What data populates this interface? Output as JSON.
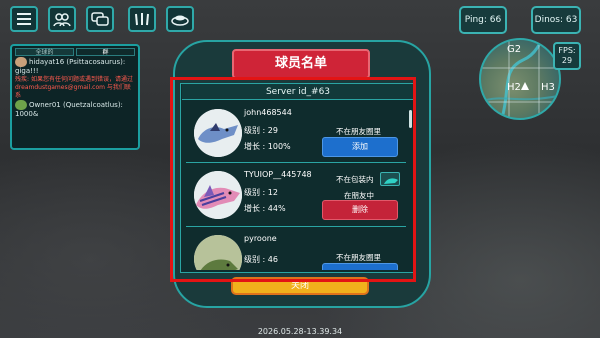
{
  "top_buttons": [
    {
      "name": "menu-button",
      "icon": "hamburger-icon"
    },
    {
      "name": "friends-button",
      "icon": "people-icon"
    },
    {
      "name": "chat-button",
      "icon": "chat-bubbles-icon"
    },
    {
      "name": "dino-button",
      "icon": "claw-icon"
    },
    {
      "name": "nest-button",
      "icon": "nest-icon"
    }
  ],
  "stats": {
    "ping": "Ping: 66",
    "dinos": "Dinos: 63",
    "fps_label": "FPS:",
    "fps_value": "29"
  },
  "chat": {
    "tabs": [
      "全球的",
      "群"
    ],
    "messages": [
      {
        "user": "hidayat16 (Psittacosaurus):",
        "text": "giga!!!"
      },
      {
        "system_label": "残疾:",
        "system_text": "如果您有任何问题或遇到错误，请通过 dreamdustgames@gmail.com 与我们联系"
      },
      {
        "user": "Owner01 (Quetzalcoatlus):",
        "text": "1000&"
      }
    ]
  },
  "map": {
    "labels": [
      "G2",
      "H2",
      "H3"
    ]
  },
  "dialog": {
    "title": "球员名单",
    "server": "Server id_#63",
    "players": [
      {
        "name": "john468544",
        "level": "级别 : 29",
        "growth": "增长 : 100%",
        "status": "不在朋友圈里",
        "status2": "",
        "action": "添加",
        "action_type": "add"
      },
      {
        "name": "TYUIOP__445748",
        "level": "级别 : 12",
        "growth": "增长 : 44%",
        "status": "不在包装内",
        "status2": "在朋友中",
        "action": "删除",
        "action_type": "remove"
      },
      {
        "name": "pyroone",
        "level": "级别 : 46",
        "growth": "",
        "status": "不在朋友圈里",
        "status2": "",
        "action": "",
        "action_type": "add"
      }
    ],
    "close": "关闭"
  },
  "timestamp": "2026.05.28-13.39.34",
  "colors": {
    "teal": "#27a4a3",
    "title_red": "#cf2437",
    "add_blue": "#1d6fcd",
    "remove_red": "#c42339",
    "close_yellow": "#f1b11c",
    "highlight": "#e31414"
  }
}
